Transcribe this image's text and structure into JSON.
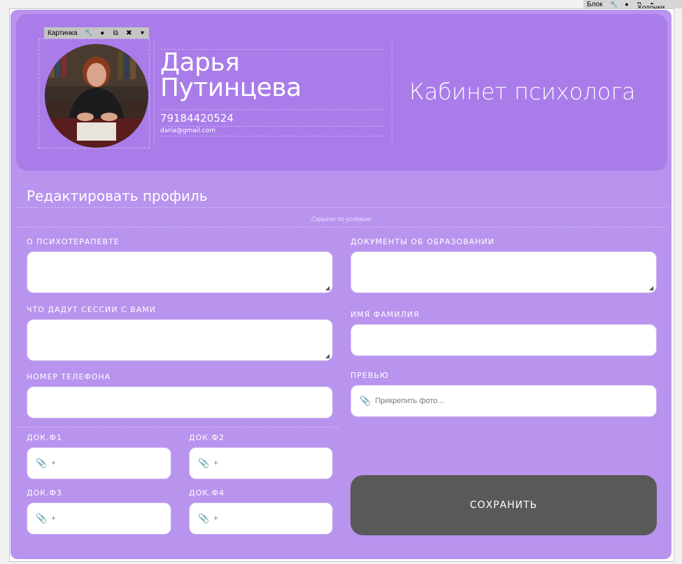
{
  "toolbar_block": {
    "label": "Блок",
    "columns_label": "Колонки"
  },
  "toolbar_picture": {
    "label": "Картинка"
  },
  "profile": {
    "name_line1": "Дарья",
    "name_line2": "Путинцева",
    "phone": "79184420524",
    "email": "daria@gmail.com",
    "cabinet_title": "Кабинет психолога"
  },
  "form": {
    "title": "Редактировать профиль",
    "hidden_note": "Скрыто по условию",
    "about_label": "О ПСИХОТЕРАПЕВТЕ",
    "sessions_label": "ЧТО ДАДУТ СЕССИИ С ВАМИ",
    "phone_label": "НОМЕР ТЕЛЕФОНА",
    "docs_label": "ДОКУМЕНТЫ ОБ ОБРАЗОВАНИИ",
    "name_label": "ИМЯ ФАМИЛИЯ",
    "preview_label": "ПРЕВЬЮ",
    "preview_placeholder": "Прикрепить фото...",
    "doc1_label": "ДОК.Ф1",
    "doc2_label": "ДОК.Ф2",
    "doc3_label": "ДОК.Ф3",
    "doc4_label": "ДОК.Ф4",
    "file_placeholder": "+",
    "save_label": "СОХРАНИТЬ"
  },
  "colors": {
    "header": "#a97ce9",
    "panel": "#b894ee",
    "save_button": "#595959"
  },
  "icons": [
    "wrench-icon",
    "drop-icon",
    "copy-icon",
    "close-icon",
    "dropdown-icon",
    "paperclip-icon",
    "resize-grip-icon"
  ]
}
